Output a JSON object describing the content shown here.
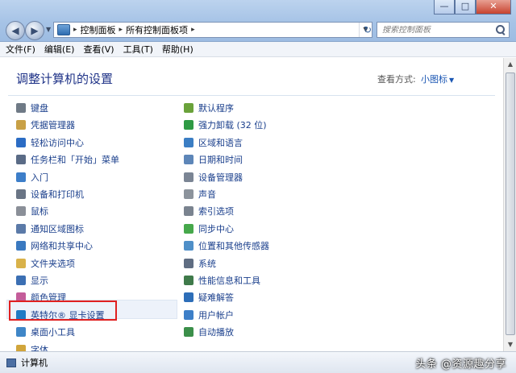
{
  "address": {
    "crumbs": [
      "控制面板",
      "所有控制面板项"
    ]
  },
  "search": {
    "placeholder": "搜索控制面板"
  },
  "menu": [
    "文件(F)",
    "编辑(E)",
    "查看(V)",
    "工具(T)",
    "帮助(H)"
  ],
  "content": {
    "title": "调整计算机的设置",
    "view_by_label": "查看方式:",
    "view_mode": "小图标"
  },
  "left_items": [
    {
      "label": "键盘",
      "icon": "keyboard-icon",
      "color": "#6f7a86"
    },
    {
      "label": "凭据管理器",
      "icon": "credential-icon",
      "color": "#c8a046"
    },
    {
      "label": "轻松访问中心",
      "icon": "ease-of-access-icon",
      "color": "#2b6cc4"
    },
    {
      "label": "任务栏和「开始」菜单",
      "icon": "taskbar-icon",
      "color": "#5a6b86"
    },
    {
      "label": "入门",
      "icon": "getting-started-icon",
      "color": "#3d7ec9"
    },
    {
      "label": "设备和打印机",
      "icon": "printer-icon",
      "color": "#6a7585"
    },
    {
      "label": "鼠标",
      "icon": "mouse-icon",
      "color": "#8a8f98"
    },
    {
      "label": "通知区域图标",
      "icon": "notification-icon",
      "color": "#5b7aa8"
    },
    {
      "label": "网络和共享中心",
      "icon": "network-icon",
      "color": "#3a79c0"
    },
    {
      "label": "文件夹选项",
      "icon": "folder-options-icon",
      "color": "#d9b24a"
    },
    {
      "label": "显示",
      "icon": "display-icon",
      "color": "#3b6fb3"
    },
    {
      "label": "颜色管理",
      "icon": "color-management-icon",
      "color": "#c45d9a"
    },
    {
      "label": "英特尔® 显卡设置",
      "icon": "intel-graphics-icon",
      "color": "#1f7bc4"
    },
    {
      "label": "桌面小工具",
      "icon": "gadgets-icon",
      "color": "#3f86c7"
    },
    {
      "label": "字体",
      "icon": "fonts-icon",
      "color": "#d1a53b"
    }
  ],
  "right_items": [
    {
      "label": "默认程序",
      "icon": "default-programs-icon",
      "color": "#6aa23a"
    },
    {
      "label": "强力卸载 (32 位)",
      "icon": "uninstaller-icon",
      "color": "#2e9a44"
    },
    {
      "label": "区域和语言",
      "icon": "region-language-icon",
      "color": "#3b7ec4"
    },
    {
      "label": "日期和时间",
      "icon": "date-time-icon",
      "color": "#5d86b8"
    },
    {
      "label": "设备管理器",
      "icon": "device-manager-icon",
      "color": "#7b8594"
    },
    {
      "label": "声音",
      "icon": "sound-icon",
      "color": "#8c939c"
    },
    {
      "label": "索引选项",
      "icon": "indexing-icon",
      "color": "#7a838f"
    },
    {
      "label": "同步中心",
      "icon": "sync-center-icon",
      "color": "#46a84b"
    },
    {
      "label": "位置和其他传感器",
      "icon": "sensors-icon",
      "color": "#4f8fc8"
    },
    {
      "label": "系统",
      "icon": "system-icon",
      "color": "#5f6d82"
    },
    {
      "label": "性能信息和工具",
      "icon": "performance-icon",
      "color": "#3f7a4a"
    },
    {
      "label": "疑难解答",
      "icon": "troubleshooting-icon",
      "color": "#2d6eb8"
    },
    {
      "label": "用户帐户",
      "icon": "user-accounts-icon",
      "color": "#3d7fc8"
    },
    {
      "label": "自动播放",
      "icon": "autoplay-icon",
      "color": "#3b8f4a"
    }
  ],
  "status": {
    "text": "计算机"
  },
  "watermark": "头条 @资源趣分享"
}
